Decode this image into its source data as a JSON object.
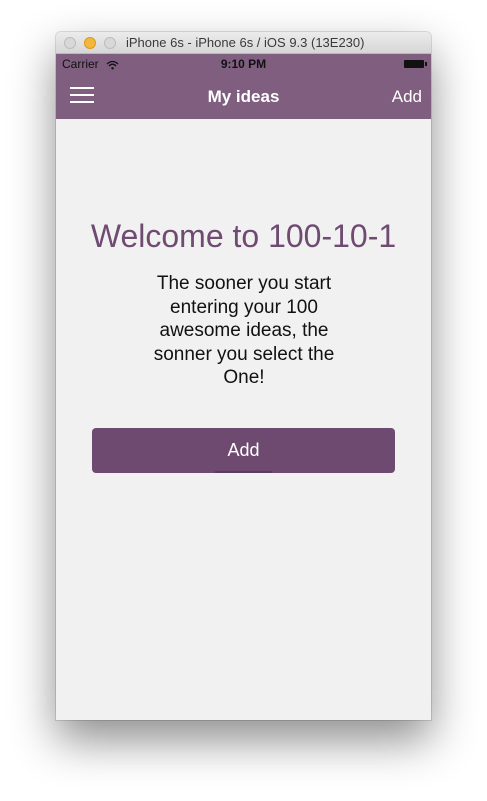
{
  "window": {
    "title": "iPhone 6s - iPhone 6s / iOS 9.3 (13E230)"
  },
  "status_bar": {
    "carrier": "Carrier",
    "time": "9:10 PM",
    "icons": [
      "wifi-icon",
      "battery-icon"
    ]
  },
  "nav": {
    "title": "My ideas",
    "right_button": "Add",
    "left_icon": "menu-icon"
  },
  "main": {
    "heading": "Welcome to 100-10-1",
    "body": "The sooner you start entering your 100 awesome ideas, the sonner you select the One!",
    "add_button": "Add"
  },
  "colors": {
    "brand": "#7f5e80",
    "button": "#6e4a71",
    "heading": "#6f4b72",
    "background": "#f1f1f1"
  }
}
